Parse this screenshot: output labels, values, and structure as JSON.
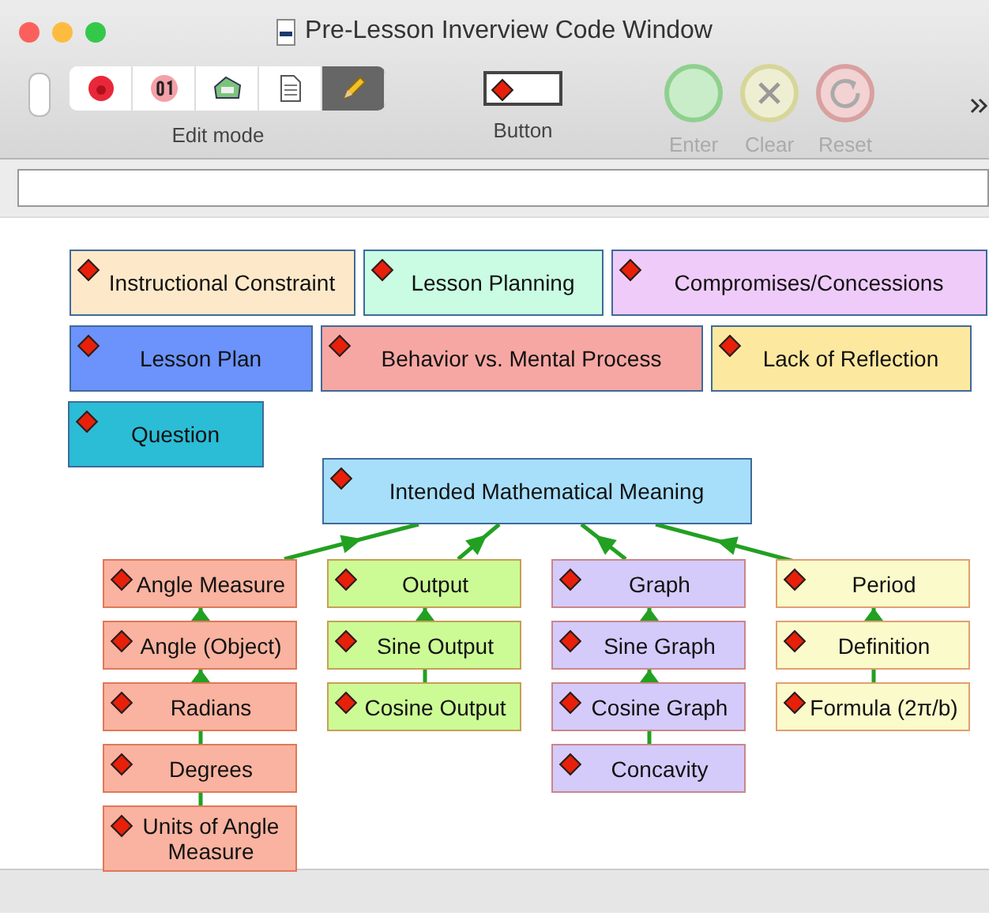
{
  "window": {
    "title": "Pre-Lesson Inverview Code Window"
  },
  "toolbar": {
    "segments": [
      {
        "kind": "record",
        "selected": false
      },
      {
        "kind": "number",
        "selected": false
      },
      {
        "kind": "tag",
        "selected": false
      },
      {
        "kind": "document",
        "selected": false
      },
      {
        "kind": "pencil",
        "selected": true
      }
    ],
    "edit_mode_label": "Edit mode",
    "button_label": "Button",
    "actions": [
      {
        "kind": "enter",
        "label": "Enter",
        "disabled": true
      },
      {
        "kind": "clear",
        "label": "Clear",
        "disabled": true
      },
      {
        "kind": "reset",
        "label": "Reset",
        "disabled": true
      }
    ]
  },
  "code_tag_rows": [
    [
      {
        "label": "Instructional Constraint",
        "color": "#fde9c9"
      },
      {
        "label": "Lesson Planning",
        "color": "#c9fce2"
      },
      {
        "label": "Compromises/Concessions",
        "color": "#efcbfa"
      }
    ],
    [
      {
        "label": "Lesson Plan",
        "color": "#6b93fb"
      },
      {
        "label": "Behavior vs. Mental Process",
        "color": "#f7a7a3"
      },
      {
        "label": "Lack of Reflection",
        "color": "#fde89f"
      }
    ],
    [
      {
        "label": "Question",
        "color": "#2bbcd6"
      }
    ]
  ],
  "concept_map": {
    "root": {
      "label": "Intended Mathematical Meaning",
      "color": "#a7dffb"
    },
    "branches": [
      {
        "color": "#f9b3a0",
        "items": [
          {
            "label": "Angle Measure"
          },
          {
            "label": "Angle (Object)",
            "arrow": true
          },
          {
            "label": "Radians",
            "arrow": true
          },
          {
            "label": "Degrees",
            "arrow": false
          },
          {
            "label": "Units of Angle Measure",
            "arrow": false
          }
        ]
      },
      {
        "color": "#ccfb96",
        "items": [
          {
            "label": "Output"
          },
          {
            "label": "Sine Output",
            "arrow": true
          },
          {
            "label": "Cosine Output",
            "arrow": false
          }
        ]
      },
      {
        "color": "#d4cbfb",
        "items": [
          {
            "label": "Graph"
          },
          {
            "label": "Sine Graph",
            "arrow": true
          },
          {
            "label": "Cosine Graph",
            "arrow": true
          },
          {
            "label": "Concavity",
            "arrow": false
          }
        ]
      },
      {
        "color": "#fafacb",
        "items": [
          {
            "label": "Period"
          },
          {
            "label": "Definition",
            "arrow": true
          },
          {
            "label": "Formula (2π/b)",
            "arrow": false
          }
        ]
      }
    ]
  }
}
